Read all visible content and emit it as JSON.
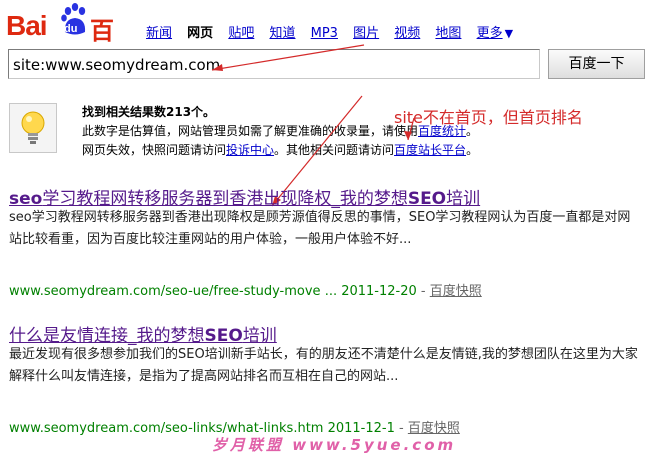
{
  "logo": {
    "latin": "Bai",
    "paw_text": "du",
    "chinese": "百度"
  },
  "nav": {
    "items": [
      "新闻",
      "网页",
      "贴吧",
      "知道",
      "MP3",
      "图片",
      "视频",
      "地图",
      "更多"
    ],
    "active_index": 1,
    "more_arrow": "▼"
  },
  "search": {
    "query": "site:www.seomydream.com",
    "button_label": "百度一下"
  },
  "notice": {
    "line1_prefix": "找到相关结果数213个。",
    "line2_a": "此数字是估算值，网站管理员如需了解更准确的收录量，请使用",
    "line2_link": "百度统计",
    "line2_b": "。",
    "line3_a": "网页失效，快照问题请访问",
    "line3_link1": "投诉中心",
    "line3_b": "。其他相关问题请访问",
    "line3_link2": "百度站长平台",
    "line3_c": "。"
  },
  "annotation": "site不在首页，但首页排名",
  "results": [
    {
      "title_a": "seo",
      "title_b": "学习教程网转移服务器到香港出现降权_我的梦想",
      "title_c": "SEO",
      "title_d": "培训",
      "snippet": "seo学习教程网转移服务器到香港出现降权是顾芳源值得反思的事情，SEO学习教程网认为百度一直都是对网站比较看重，因为百度比较注重网站的用户体验，一般用户体验不好...",
      "url": "www.seomydream.com/seo-ue/free-study-move ... 2011-12-20",
      "sep": " - ",
      "cache": "百度快照"
    },
    {
      "title_a": "什么是友情连接_我的梦想",
      "title_b": "",
      "title_c": "SEO",
      "title_d": "培训",
      "snippet": "最近发现有很多想参加我们的SEO培训新手站长，有的朋友还不清楚什么是友情链,我的梦想团队在这里为大家解释什么叫友情连接，是指为了提高网站排名而互相在自己的网站...",
      "url": "www.seomydream.com/seo-links/what-links.htm 2011-12-1",
      "sep": " - ",
      "cache": "百度快照"
    }
  ],
  "watermark": "岁月联盟  www.5yue.com",
  "colors": {
    "brand_red": "#de2910",
    "link_blue": "#0000cc",
    "visited_purple": "#551a8b",
    "url_green": "#008000",
    "annotation_red": "#d42a2a"
  }
}
